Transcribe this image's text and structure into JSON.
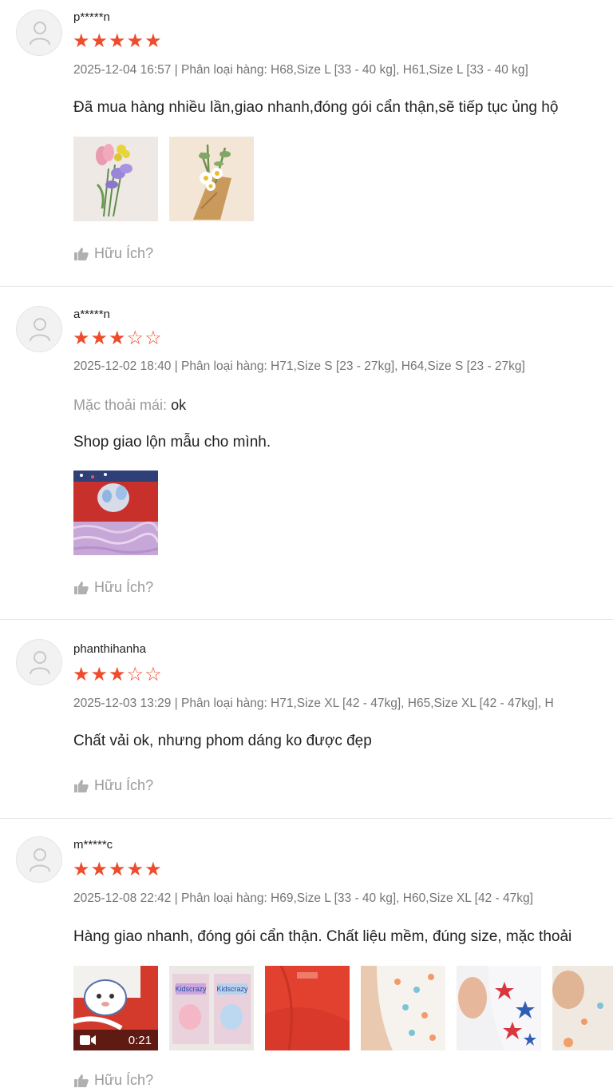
{
  "reviews": [
    {
      "username": "p*****n",
      "rating": 5,
      "meta": "2025-12-04 16:57 | Phân loại hàng: H68,Size L [33 - 40 kg], H61,Size L [33 - 40 kg]",
      "content": "Đã mua hàng nhiều lần,giao nhanh,đóng gói cẩn thận,sẽ tiếp tục ủng hộ",
      "helpful_label": "Hữu Ích?"
    },
    {
      "username": "a*****n",
      "rating": 3,
      "meta": "2025-12-02 18:40 | Phân loại hàng: H71,Size S [23 - 27kg], H64,Size S [23 - 27kg]",
      "attr_label": "Mặc thoải mái:",
      "attr_value": "ok",
      "content": "Shop giao lộn mẫu cho mình.",
      "helpful_label": "Hữu Ích?"
    },
    {
      "username": "phanthihanha",
      "rating": 3,
      "meta": "2025-12-03 13:29 | Phân loại hàng: H71,Size XL [42 - 47kg], H65,Size XL [42 - 47kg], H",
      "content": "Chất vải ok, nhưng phom dáng ko được đẹp",
      "helpful_label": "Hữu Ích?"
    },
    {
      "username": "m*****c",
      "rating": 5,
      "meta": "2025-12-08 22:42 | Phân loại hàng: H69,Size L [33 - 40 kg], H60,Size XL [42 - 47kg]",
      "content": "Hàng giao nhanh, đóng gói cẩn thận. Chất liệu mềm, đúng size, mặc thoải",
      "video_duration": "0:21",
      "thumb_texts": [
        "Kidscrazy",
        "Kidscrazy"
      ],
      "helpful_label": "Hữu Ích?"
    }
  ],
  "colors": {
    "star": "#ee4d2d",
    "meta_text": "#757575",
    "muted_text": "#9a9a9a",
    "divider": "#e8e8e8"
  },
  "icons": {
    "avatar": "user-icon",
    "helpful": "thumbs-up-icon",
    "video": "video-camera-icon",
    "star": "star-icon"
  }
}
